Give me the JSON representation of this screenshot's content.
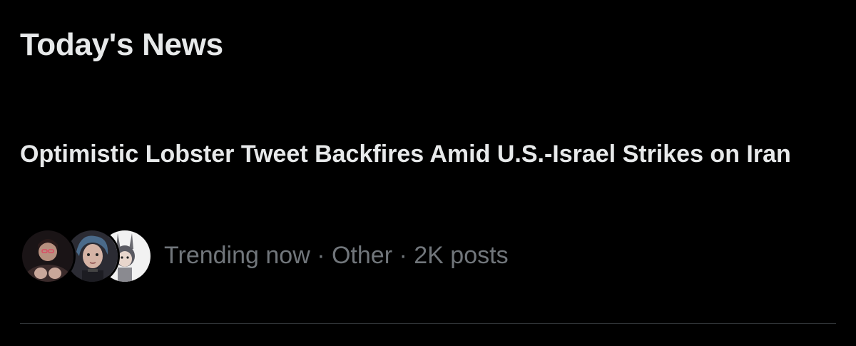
{
  "section": {
    "title": "Today's News"
  },
  "news_item": {
    "headline": "Optimistic Lobster Tweet Backfires Amid U.S.-Israel Strikes on Iran",
    "avatars": [
      "avatar-1",
      "avatar-2",
      "avatar-3"
    ],
    "meta": {
      "status": "Trending now",
      "separator": "·",
      "category": "Other",
      "post_count": "2K posts"
    }
  },
  "colors": {
    "background": "#000000",
    "primary_text": "#e7e9ea",
    "secondary_text": "#71767b",
    "divider": "#2f3336"
  }
}
